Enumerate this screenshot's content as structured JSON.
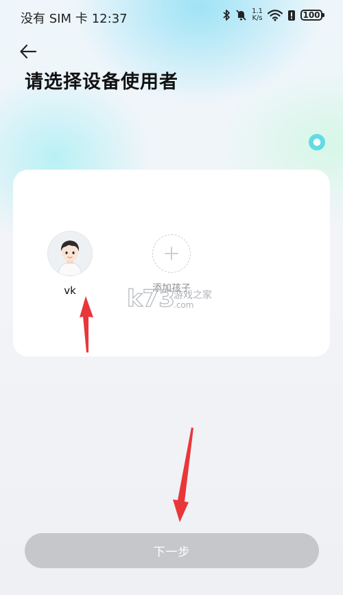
{
  "status_bar": {
    "carrier": "没有 SIM 卡",
    "time": "12:37",
    "speed_value": "1.1",
    "speed_unit": "K/s",
    "battery": "100"
  },
  "header": {
    "title": "请选择设备使用者"
  },
  "users": [
    {
      "name": "vk"
    }
  ],
  "add_child": {
    "label": "添加孩子"
  },
  "watermark": {
    "text": "k73",
    "subtext": "游戏之家",
    "domain": ".com"
  },
  "footer": {
    "next_label": "下一步"
  },
  "colors": {
    "accent_ring": "#62dbe4",
    "annotation_arrow": "#e8373a",
    "button_disabled": "#c5c7cb"
  }
}
